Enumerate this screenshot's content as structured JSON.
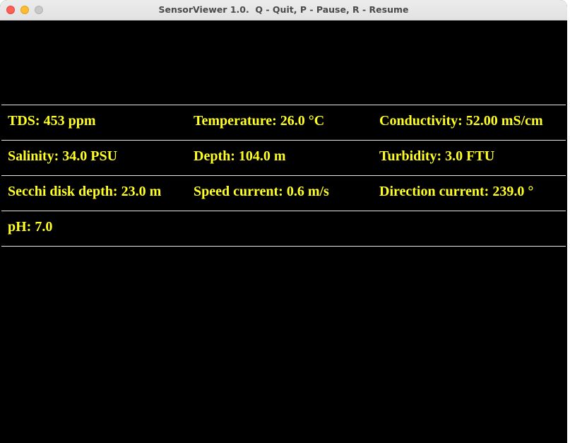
{
  "window": {
    "title": "SensorViewer 1.0.  Q - Quit, P - Pause, R - Resume",
    "controls": {
      "close_color": "#ff5f57",
      "minimize_color": "#febc2e",
      "zoom_color": "#c8c8c8"
    }
  },
  "theme": {
    "background": "#000000",
    "text_color": "#ffff22",
    "line_color": "#e6e6e6"
  },
  "readings": {
    "row1": {
      "tds": "TDS: 453 ppm",
      "temperature": "Temperature: 26.0 °C",
      "conductivity": "Conductivity: 52.00 mS/cm"
    },
    "row2": {
      "salinity": "Salinity: 34.0 PSU",
      "depth": "Depth: 104.0 m",
      "turbidity": "Turbidity: 3.0 FTU"
    },
    "row3": {
      "secchi": "Secchi disk depth: 23.0 m",
      "speed_current": "Speed current: 0.6 m/s",
      "direction_current": "Direction current: 239.0 °"
    },
    "row4": {
      "ph": "pH: 7.0"
    }
  }
}
